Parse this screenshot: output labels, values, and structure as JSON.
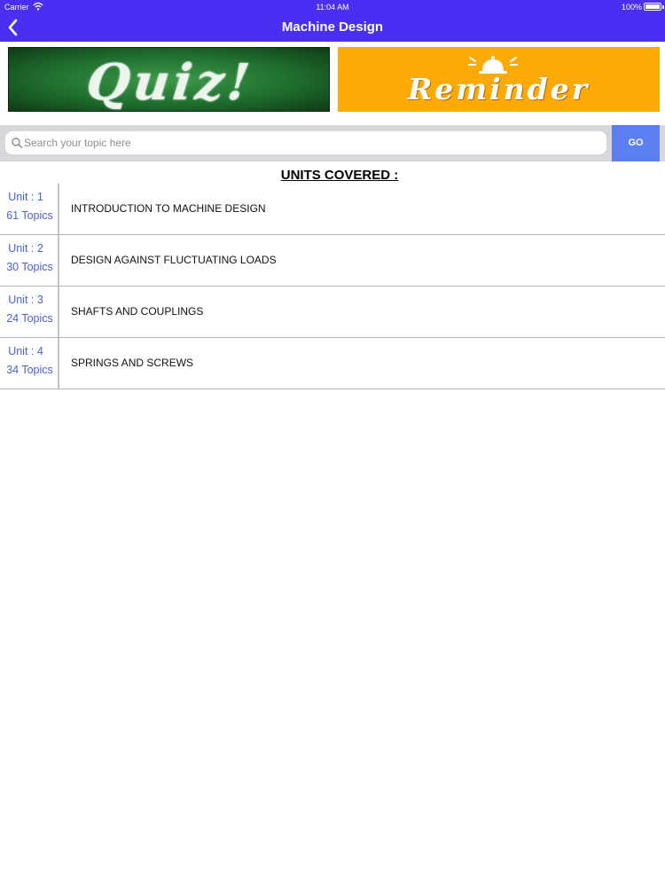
{
  "status_bar": {
    "carrier": "Carrier",
    "time": "11:04 AM",
    "battery": "100%"
  },
  "nav": {
    "title": "Machine Design",
    "back_icon": "chevron-left-icon"
  },
  "banners": {
    "quiz_text": "Quiz!",
    "reminder_text": "Reminder"
  },
  "search": {
    "placeholder": "Search your topic here",
    "value": "",
    "go_label": "GO"
  },
  "units_heading": "UNITS COVERED :",
  "units": [
    {
      "number": "Unit : 1",
      "topics": "61 Topics",
      "title": "INTRODUCTION TO MACHINE DESIGN"
    },
    {
      "number": "Unit : 2",
      "topics": "30 Topics",
      "title": "DESIGN AGAINST FLUCTUATING LOADS"
    },
    {
      "number": "Unit : 3",
      "topics": "24 Topics",
      "title": "SHAFTS AND COUPLINGS"
    },
    {
      "number": "Unit : 4",
      "topics": "34 Topics",
      "title": "SPRINGS AND SCREWS"
    }
  ],
  "colors": {
    "nav_bar": "#4a2ff2",
    "go_button": "#5b7ff0",
    "unit_text": "#4a5fd8",
    "reminder_bg": "#fdaa06",
    "quiz_bg": "#2a7a36"
  }
}
